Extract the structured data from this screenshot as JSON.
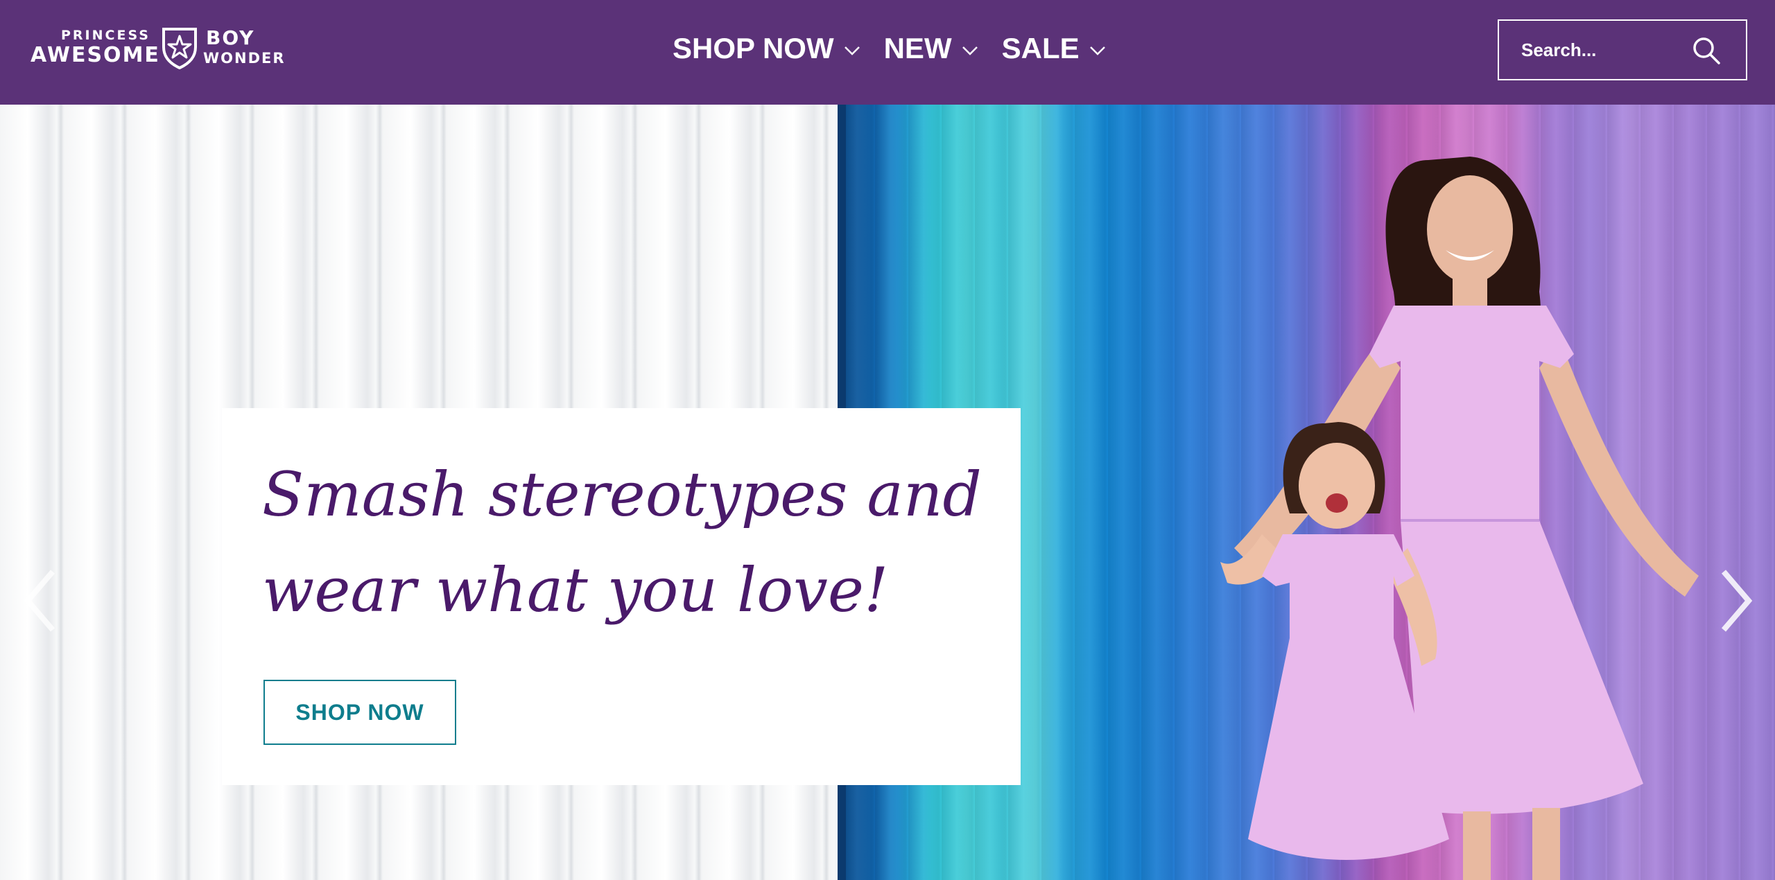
{
  "header": {
    "logo": {
      "line1": "PRINCESS",
      "line2": "AWESOME",
      "line3": "BOY",
      "line4": "WONDER"
    },
    "nav": [
      {
        "label": "SHOP NOW",
        "icon": "chevron-down-icon"
      },
      {
        "label": "NEW",
        "icon": "chevron-down-icon"
      },
      {
        "label": "SALE",
        "icon": "chevron-down-icon"
      }
    ],
    "search": {
      "placeholder": "Search...",
      "icon": "search-icon"
    }
  },
  "hero": {
    "headline": "Smash stereotypes and wear what you love!",
    "cta_label": "SHOP NOW",
    "prev_icon": "chevron-left-icon",
    "next_icon": "chevron-right-icon"
  },
  "colors": {
    "header_bg": "#5b3278",
    "headline": "#4a1a6a",
    "cta": "#0e7d8d"
  }
}
